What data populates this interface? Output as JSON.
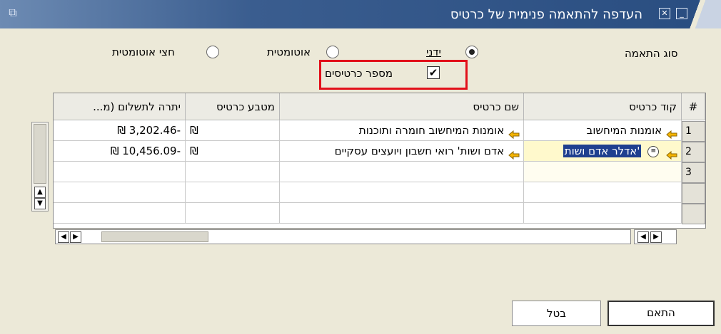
{
  "window": {
    "title": "העדפה להתאמה פנימית של כרטיס"
  },
  "match_type": {
    "label": "סוג התאמה",
    "options": [
      {
        "label": "ידני",
        "checked": true
      },
      {
        "label": "אוטומטית",
        "checked": false
      },
      {
        "label": "חצי אוטומטית",
        "checked": false
      }
    ]
  },
  "card_number_checkbox": {
    "label": "מספר כרטיסים",
    "checked": true
  },
  "table": {
    "columns": [
      "#",
      "קוד כרטיס",
      "שם כרטיס",
      "מטבע כרטיס",
      "יתרה לתשלום (מ..."
    ],
    "rows": [
      {
        "num": "1",
        "code": "אומנות המיחשוב",
        "name": "אומנות המיחשוב חומרה ותוכנות",
        "currency": "₪",
        "balance": "₪ 3,202.46-"
      },
      {
        "num": "2",
        "code": "'אדלר אדם ושות",
        "name": "אדם ושות' רואי חשבון ויועצים עסקיים",
        "currency": "₪",
        "balance": "₪ 10,456.09-"
      },
      {
        "num": "3",
        "code": "",
        "name": "",
        "currency": "",
        "balance": ""
      },
      {
        "num": "",
        "code": "",
        "name": "",
        "currency": "",
        "balance": ""
      },
      {
        "num": "",
        "code": "",
        "name": "",
        "currency": "",
        "balance": ""
      }
    ]
  },
  "buttons": {
    "match": "התאם",
    "cancel": "בטל"
  },
  "colors": {
    "titlebar": "#294d80",
    "link_arrow": "#f5b400",
    "highlight": "#e2101a",
    "selected_cell": "#fff9cc"
  }
}
